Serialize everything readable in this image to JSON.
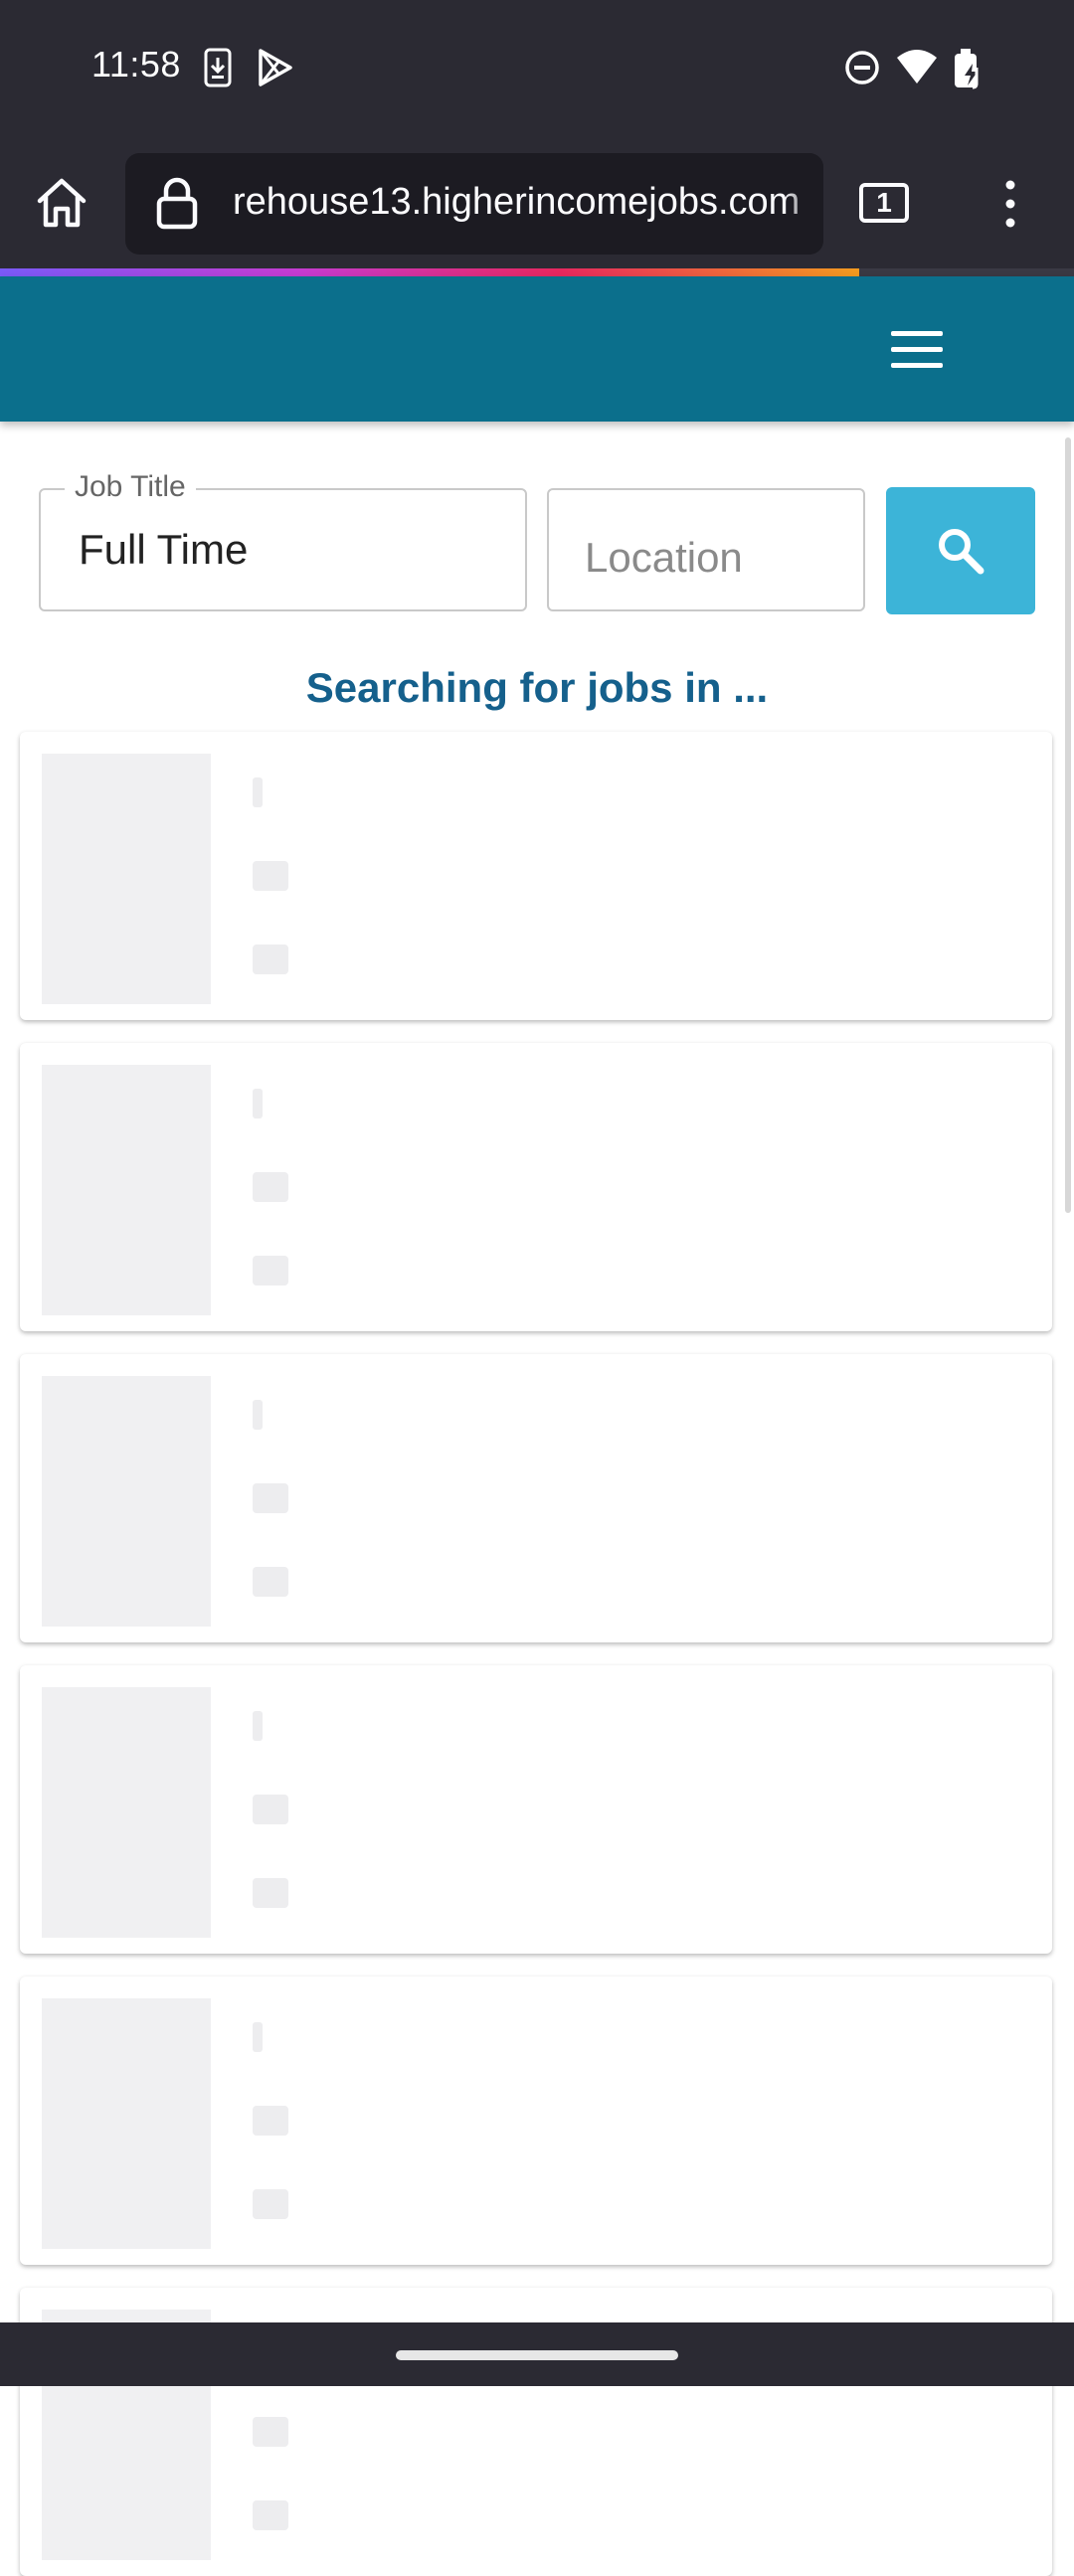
{
  "status_bar": {
    "time": "11:58",
    "icons_left": [
      "download-notification-icon",
      "play-store-icon"
    ],
    "icons_right": [
      "do-not-disturb-icon",
      "wifi-icon",
      "battery-icon"
    ]
  },
  "browser": {
    "url": "rehouse13.higherincomejobs.com",
    "tab_count": "1",
    "icons": [
      "home-icon",
      "lock-icon",
      "tabs-icon",
      "overflow-menu-icon"
    ],
    "load_progress": 0.8
  },
  "site": {
    "header_color": "#0b6f8c",
    "menu_icon": "hamburger-menu-icon"
  },
  "search": {
    "job_title_label": "Job Title",
    "job_title_value": "Full Time",
    "location_placeholder": "Location",
    "button_icon": "search-icon",
    "accent_color": "#3cb4d8"
  },
  "results": {
    "status_text": "Searching for jobs in ...",
    "placeholder_cards": 6
  }
}
